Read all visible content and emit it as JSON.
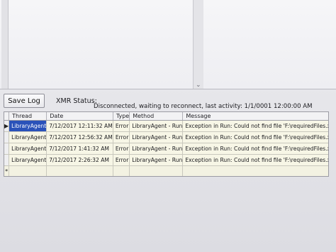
{
  "toolbar": {
    "save_label": "Save Log"
  },
  "status": {
    "label": "XMR Status:",
    "text": "Disconnected, waiting to reconnect, last activity: 1/1/0001 12:00:00 AM"
  },
  "grid": {
    "columns": [
      "Thread",
      "Date",
      "Type",
      "Method",
      "Message"
    ],
    "rows": [
      {
        "thread": "LibraryAgent",
        "date": "7/12/2017 12:11:32 AM",
        "type": "Error",
        "method": "LibraryAgent - Run",
        "message": "Exception in Run: Could not find file 'F:\\requiredFiles.xml'."
      },
      {
        "thread": "LibraryAgent",
        "date": "7/12/2017 12:56:32 AM",
        "type": "Error",
        "method": "LibraryAgent - Run",
        "message": "Exception in Run: Could not find file 'F:\\requiredFiles.xml'."
      },
      {
        "thread": "LibraryAgent",
        "date": "7/12/2017 1:41:32 AM",
        "type": "Error",
        "method": "LibraryAgent - Run",
        "message": "Exception in Run: Could not find file 'F:\\requiredFiles.xml'."
      },
      {
        "thread": "LibraryAgent",
        "date": "7/12/2017 2:26:32 AM",
        "type": "Error",
        "method": "LibraryAgent - Run",
        "message": "Exception in Run: Could not find file 'F:\\requiredFiles.xml'."
      }
    ],
    "current_row_marker": "▶",
    "new_row_marker": "*"
  },
  "icons": {
    "scroll_down": "chevron-down-icon",
    "row_pointer": "row-pointer-icon"
  }
}
